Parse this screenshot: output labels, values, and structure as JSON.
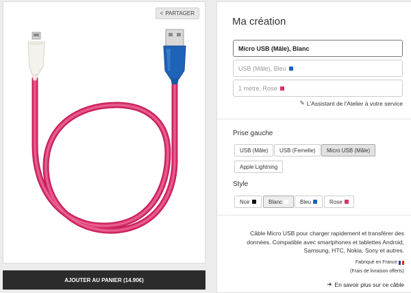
{
  "preview": {
    "share_label": "PARTAGER",
    "cable_color": "#d6336c",
    "left_plug_color": "#f3f1ea",
    "right_plug_color": "#1d63b8"
  },
  "cart": {
    "label": "AJOUTER AU PANIER (14.90€)"
  },
  "config": {
    "title": "Ma création",
    "fields": [
      {
        "label": "Micro USB (Mâle), Blanc",
        "color": ""
      },
      {
        "label": "USB (Mâle), Bleu",
        "color": "#1d63b8"
      },
      {
        "label": "1 mètre, Rose",
        "color": "#d6336c"
      }
    ],
    "assistant_link": "L'Assistant de l'Atelier à votre service",
    "connector_section": {
      "label": "Prise gauche",
      "options": [
        "USB (Mâle)",
        "USB (Femelle)",
        "Micro USB (Mâle)",
        "Apple Lightning"
      ],
      "selected": "Micro USB (Mâle)"
    },
    "style_section": {
      "label": "Style",
      "options": [
        {
          "label": "Noir",
          "color": "#111111"
        },
        {
          "label": "Blanc",
          "color": "#ffffff"
        },
        {
          "label": "Bleu",
          "color": "#1d63b8"
        },
        {
          "label": "Rose",
          "color": "#d6336c"
        }
      ],
      "selected": "Blanc"
    },
    "description": "Câble Micro USB pour charger rapidement et transférer des données. Compatible avec smartphones et tablettes Android, Samsung, HTC, Nokia, Sony et autres.",
    "made_in": "Fabriqué en France",
    "shipping": "(Frais de livraison offerts)",
    "more_link": "En savoir plus sur ce câble"
  }
}
